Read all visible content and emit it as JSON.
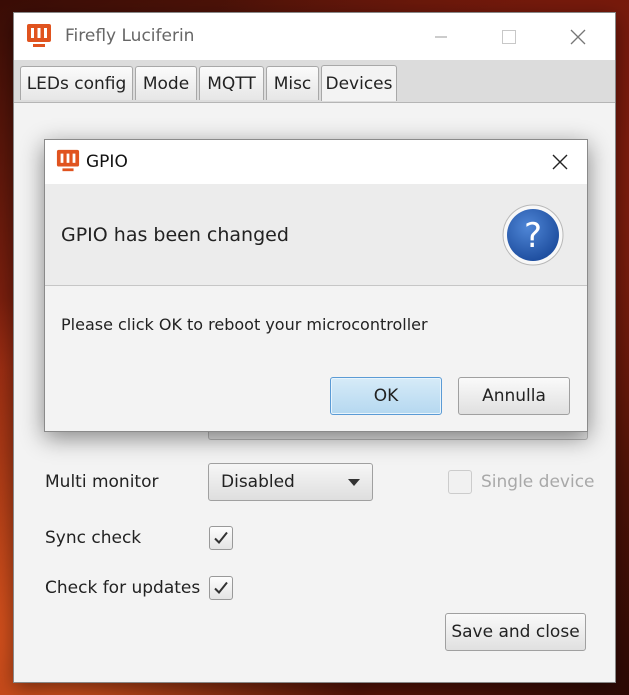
{
  "window": {
    "title": "Firefly Luciferin",
    "brand_color": "#e0531f"
  },
  "tabs": [
    {
      "label": "LEDs config",
      "active": false
    },
    {
      "label": "Mode",
      "active": false
    },
    {
      "label": "MQTT",
      "active": false
    },
    {
      "label": "Misc",
      "active": false
    },
    {
      "label": "Devices",
      "active": true
    }
  ],
  "devices": {
    "multi_monitor_label": "Multi monitor",
    "multi_monitor_value": "Disabled",
    "single_device_label": "Single device",
    "single_device_checked": false,
    "sync_check_label": "Sync check",
    "sync_check_checked": true,
    "check_updates_label": "Check for updates",
    "check_updates_checked": true,
    "save_label": "Save and close"
  },
  "dialog": {
    "title": "GPIO",
    "header": "GPIO has been changed",
    "message": "Please click OK to reboot your microcontroller",
    "ok_label": "OK",
    "cancel_label": "Annulla",
    "icon": "question-icon"
  }
}
